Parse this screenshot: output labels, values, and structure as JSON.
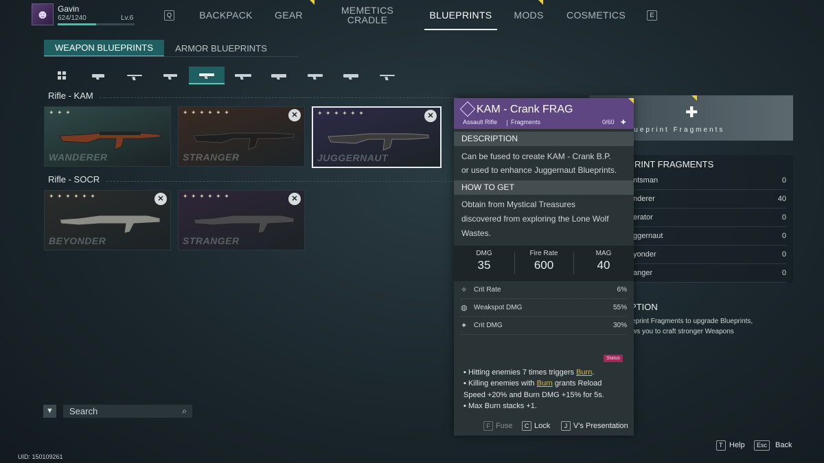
{
  "player": {
    "name": "Gavin",
    "xp": "624/1240",
    "level": "Lv.6",
    "xp_fraction": 0.503
  },
  "nav": {
    "key_left": "Q",
    "key_right": "E",
    "tabs": [
      {
        "label": "BACKPACK"
      },
      {
        "label": "GEAR"
      },
      {
        "label": "MEMETICS\nCRADLE"
      },
      {
        "label": "BLUEPRINTS"
      },
      {
        "label": "MODS"
      },
      {
        "label": "COSMETICS"
      }
    ],
    "active_tab": "BLUEPRINTS"
  },
  "subtabs": {
    "weapon": "WEAPON BLUEPRINTS",
    "armor": "ARMOR BLUEPRINTS",
    "active": "weapon"
  },
  "weapon_types": [
    "all-icon",
    "pistol-icon",
    "shotgun-icon",
    "smg-icon",
    "assault-rifle-icon",
    "rifle-icon",
    "lmg-icon",
    "sniper-icon",
    "launcher-icon",
    "crossbow-icon"
  ],
  "active_weapon_type": "assault-rifle-icon",
  "sections": [
    {
      "title": "Rifle - KAM",
      "cards": [
        {
          "rarity": "WANDERER",
          "stars": "✦ ✦ ✦",
          "fuse": false,
          "tint": "#2e4a48",
          "selected": false
        },
        {
          "rarity": "STRANGER",
          "stars": "✦ ✦ ✦ ✦ ✦ ✦",
          "fuse": true,
          "tint": "#3a2a22",
          "selected": false
        },
        {
          "rarity": "JUGGERNAUT",
          "stars": "✦ ✦ ✦ ✦ ✦ ✦",
          "fuse": true,
          "tint": "#2d2a48",
          "selected": true
        }
      ]
    },
    {
      "title": "Rifle - SOCR",
      "cards": [
        {
          "rarity": "BEYONDER",
          "stars": "✦ ✦ ✦ ✦ ✦ ✦",
          "fuse": true,
          "tint": "#2a2c2a",
          "selected": false
        },
        {
          "rarity": "STRANGER",
          "stars": "✦ ✦ ✦ ✦ ✦ ✦",
          "fuse": true,
          "tint": "#2f2538",
          "selected": false
        }
      ]
    }
  ],
  "search": {
    "placeholder": "Search"
  },
  "uid": "UID: 150109261",
  "side_panel": {
    "banner": "lueprint Fragments",
    "list_title": "T BLUEPRINT FRAGMENTS",
    "rows": [
      {
        "name": "ntsman",
        "value": "0"
      },
      {
        "name": "nderer",
        "value": "40"
      },
      {
        "name": "erator",
        "value": "0"
      },
      {
        "name": "ggernaut",
        "value": "0"
      },
      {
        "name": "yonder",
        "value": "0"
      },
      {
        "name": "anger",
        "value": "0"
      }
    ],
    "desc_title": "PTION",
    "desc_lines": [
      "eprint Fragments to upgrade Blueprints,",
      "ws you to craft stronger Weapons"
    ]
  },
  "popup": {
    "title": "KAM - Crank FRAG",
    "type": "Assault Rifle",
    "category": "Fragments",
    "count": "0/60",
    "description_label": "DESCRIPTION",
    "description_lines": [
      "Can be fused to create KAM - Crank B.P.",
      "or used to enhance Juggernaut Blueprints."
    ],
    "how_label": "HOW TO GET",
    "how_lines": [
      "Obtain from Mystical Treasures",
      "discovered from exploring the Lone Wolf",
      "Wastes."
    ],
    "stats": [
      {
        "label": "DMG",
        "value": "35"
      },
      {
        "label": "Fire Rate",
        "value": "600"
      },
      {
        "label": "MAG",
        "value": "40"
      }
    ],
    "substats": [
      {
        "icon": "crit-rate-icon",
        "label": "Crit Rate",
        "value": "6%"
      },
      {
        "icon": "weakspot-icon",
        "label": "Weakspot DMG",
        "value": "55%"
      },
      {
        "icon": "crit-dmg-icon",
        "label": "Crit DMG",
        "value": "30%"
      }
    ],
    "status_tag": "Status",
    "effects": {
      "l1a": "▪ Hitting enemies 7 times triggers ",
      "l1burn": "Burn",
      "l1b": ".",
      "l2a": "▪ Killing enemies with ",
      "l2burn": " Burn",
      "l2b": " grants Reload",
      "l3": "Speed +20% and Burn DMG +15% for 5s.",
      "l4": "▪ Max Burn stacks +1."
    },
    "footer": [
      {
        "key": "F",
        "label": "Fuse"
      },
      {
        "key": "C",
        "label": "Lock"
      },
      {
        "key": "J",
        "label": "V's Presentation"
      }
    ]
  },
  "bottom_right": [
    {
      "key": "T",
      "label": "Help"
    },
    {
      "key": "Esc",
      "label": "Back"
    }
  ]
}
